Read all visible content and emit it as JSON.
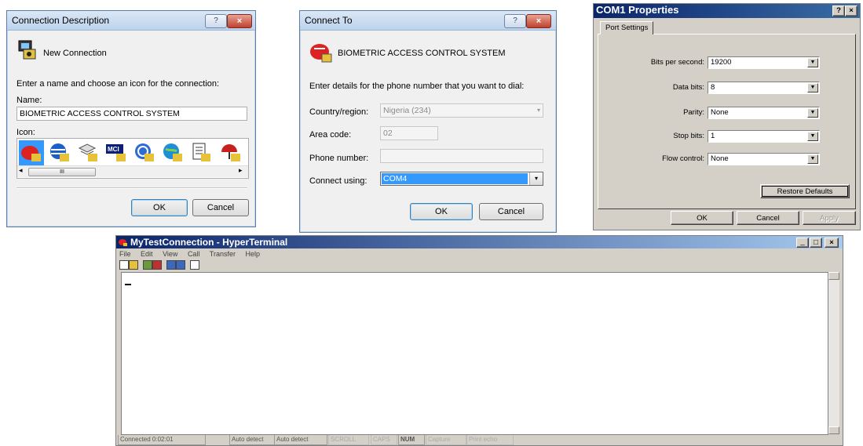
{
  "conn_desc": {
    "title": "Connection Description",
    "help_glyph": "?",
    "close_glyph": "×",
    "header": "New Connection",
    "instruction": "Enter a name and choose an icon for the connection:",
    "name_label": "Name:",
    "name_value": "BIOMETRIC ACCESS CONTROL SYSTEM",
    "icon_label": "Icon:",
    "scroll_thumb": "III",
    "ok": "OK",
    "cancel": "Cancel"
  },
  "connect_to": {
    "title": "Connect To",
    "help_glyph": "?",
    "close_glyph": "×",
    "header": "BIOMETRIC ACCESS CONTROL SYSTEM",
    "instruction": "Enter details for the phone number that you want to dial:",
    "country_label": "Country/region:",
    "country_value": "Nigeria (234)",
    "area_label": "Area code:",
    "area_value": "02",
    "phone_label": "Phone number:",
    "phone_value": "",
    "connect_label": "Connect using:",
    "connect_value": "COM4",
    "ok": "OK",
    "cancel": "Cancel"
  },
  "com1": {
    "title": "COM1 Properties",
    "help_glyph": "?",
    "close_glyph": "×",
    "tab": "Port Settings",
    "bits_label": "Bits per second:",
    "bits_value": "19200",
    "data_label": "Data bits:",
    "data_value": "8",
    "parity_label": "Parity:",
    "parity_value": "None",
    "stop_label": "Stop bits:",
    "stop_value": "1",
    "flow_label": "Flow control:",
    "flow_value": "None",
    "restore": "Restore Defaults",
    "ok": "OK",
    "cancel": "Cancel",
    "apply": "Apply"
  },
  "hyperterm": {
    "title": "MyTestConnection - HyperTerminal",
    "menu": [
      "File",
      "Edit",
      "View",
      "Call",
      "Transfer",
      "Help"
    ],
    "window_buttons": [
      "_",
      "□",
      "×"
    ],
    "status": [
      "Connected 0:02:01",
      "Auto detect",
      "Auto detect",
      "SCROLL",
      "CAPS",
      "NUM",
      "Capture",
      "Print echo"
    ]
  }
}
